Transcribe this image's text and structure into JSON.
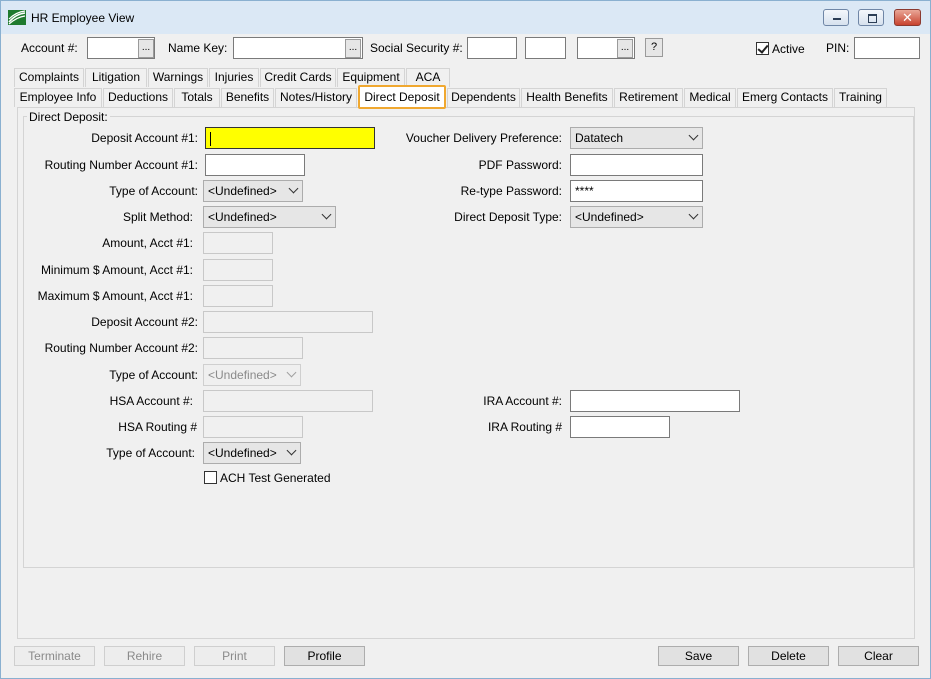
{
  "window": {
    "title": "HR Employee View",
    "close_glyph": "✕"
  },
  "header": {
    "account_label": "Account #:",
    "account_value": "",
    "name_key_label": "Name Key:",
    "name_key_value": "",
    "ssn_label": "Social Security #:",
    "ellipsis": "...",
    "help": "?",
    "active_label": "Active",
    "active_checked": true,
    "pin_label": "PIN:",
    "pin_value": ""
  },
  "tabs_row1": [
    "Complaints",
    "Litigation",
    "Warnings",
    "Injuries",
    "Credit Cards",
    "Equipment",
    "ACA"
  ],
  "tabs_row2": [
    "Employee Info",
    "Deductions",
    "Totals",
    "Benefits",
    "Notes/History",
    "Direct Deposit",
    "Dependents",
    "Health Benefits",
    "Retirement",
    "Medical",
    "Emerg Contacts",
    "Training"
  ],
  "active_tab": "Direct Deposit",
  "form": {
    "group_title": "Direct Deposit:",
    "deposit_account_1_label": "Deposit Account #1:",
    "routing_1_label": "Routing Number Account #1:",
    "type_account_1_label": "Type of Account:",
    "type_account_1_value": "<Undefined>",
    "split_method_label": "Split Method:",
    "split_method_value": "<Undefined>",
    "amount_1_label": "Amount, Acct #1:",
    "min_amount_1_label": "Minimum $ Amount, Acct #1:",
    "max_amount_1_label": "Maximum $ Amount, Acct #1:",
    "deposit_account_2_label": "Deposit Account #2:",
    "routing_2_label": "Routing Number Account #2:",
    "type_account_2_label": "Type of Account:",
    "type_account_2_value": "<Undefined>",
    "hsa_account_label": "HSA Account #:",
    "hsa_routing_label": "HSA Routing #",
    "type_account_3_label": "Type of Account:",
    "type_account_3_value": "<Undefined>",
    "ach_test_label": "ACH Test Generated",
    "voucher_label": "Voucher Delivery Preference:",
    "voucher_value": "Datatech",
    "pdf_password_label": "PDF Password:",
    "retype_password_label": "Re-type Password:",
    "retype_password_value": "****",
    "dd_type_label": "Direct Deposit Type:",
    "dd_type_value": "<Undefined>",
    "ira_account_label": "IRA Account #:",
    "ira_routing_label": "IRA Routing #"
  },
  "footer": {
    "terminate": "Terminate",
    "rehire": "Rehire",
    "print": "Print",
    "profile": "Profile",
    "save": "Save",
    "delete": "Delete",
    "clear": "Clear"
  }
}
